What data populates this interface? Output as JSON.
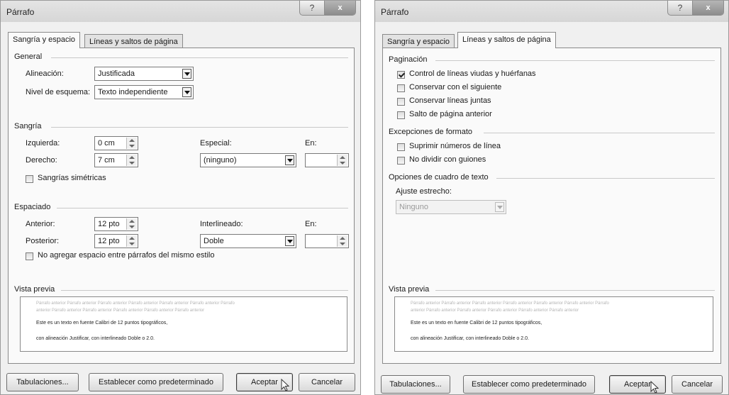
{
  "dialog_left": {
    "title": "Párrafo",
    "help_glyph": "?",
    "close_glyph": "x",
    "tabs": [
      "Sangría y espacio",
      "Líneas y saltos de página"
    ],
    "general": {
      "header": "General",
      "alignment_label": "Alineación:",
      "alignment_value": "Justificada",
      "outline_label": "Nivel de esquema:",
      "outline_value": "Texto independiente"
    },
    "indent": {
      "header": "Sangría",
      "left_label": "Izquierda:",
      "left_value": "0 cm",
      "right_label": "Derecho:",
      "right_value": "7 cm",
      "special_label": "Especial:",
      "special_value": "(ninguno)",
      "by_label": "En:",
      "by_value": "",
      "mirror_label": "Sangrías simétricas",
      "mirror_checked": false
    },
    "spacing": {
      "header": "Espaciado",
      "before_label": "Anterior:",
      "before_value": "12 pto",
      "after_label": "Posterior:",
      "after_value": "12 pto",
      "line_label": "Interlineado:",
      "line_value": "Doble",
      "at_label": "En:",
      "at_value": "",
      "no_space_label": "No agregar espacio entre párrafos del mismo estilo",
      "no_space_checked": false
    },
    "preview": {
      "header": "Vista previa",
      "faint_line1": "Párrafo anterior Párrafo anterior Párrafo anterior Párrafo anterior Párrafo anterior Párrafo anterior Párrafo",
      "faint_line2": "anterior Párrafo anterior Párrafo anterior Párrafo anterior Párrafo anterior Párrafo anterior",
      "text_line1": "Este es un texto en fuente Calibri de 12 puntos tipográficos,",
      "text_line2": "con alineación Justificar, con interlineado Doble o 2.0."
    },
    "buttons": {
      "tabs": "Tabulaciones...",
      "default": "Establecer como predeterminado",
      "ok": "Aceptar",
      "cancel": "Cancelar"
    }
  },
  "dialog_right": {
    "title": "Párrafo",
    "help_glyph": "?",
    "close_glyph": "x",
    "tabs": [
      "Sangría y espacio",
      "Líneas y saltos de página"
    ],
    "pagination": {
      "header": "Paginación",
      "items": [
        {
          "label": "Control de líneas viudas y huérfanas",
          "checked": true
        },
        {
          "label": "Conservar con el siguiente",
          "checked": false
        },
        {
          "label": "Conservar líneas juntas",
          "checked": false
        },
        {
          "label": "Salto de página anterior",
          "checked": false
        }
      ]
    },
    "exceptions": {
      "header": "Excepciones de formato",
      "items": [
        {
          "label": "Suprimir números de línea",
          "checked": false
        },
        {
          "label": "No dividir con guiones",
          "checked": false
        }
      ]
    },
    "textbox": {
      "header": "Opciones de cuadro de texto",
      "fit_label": "Ajuste estrecho:",
      "fit_value": "Ninguno"
    },
    "preview": {
      "header": "Vista previa",
      "faint_line1": "Párrafo anterior Párrafo anterior Párrafo anterior Párrafo anterior Párrafo anterior Párrafo anterior Párrafo",
      "faint_line2": "anterior Párrafo anterior Párrafo anterior Párrafo anterior Párrafo anterior Párrafo anterior",
      "text_line1": "Este es un texto en fuente Calibri de 12 puntos tipográficos,",
      "text_line2": "con alineación Justificar, con interlineado Doble o 2.0."
    },
    "buttons": {
      "tabs": "Tabulaciones...",
      "default": "Establecer como predeterminado",
      "ok": "Aceptar",
      "cancel": "Cancelar"
    }
  }
}
